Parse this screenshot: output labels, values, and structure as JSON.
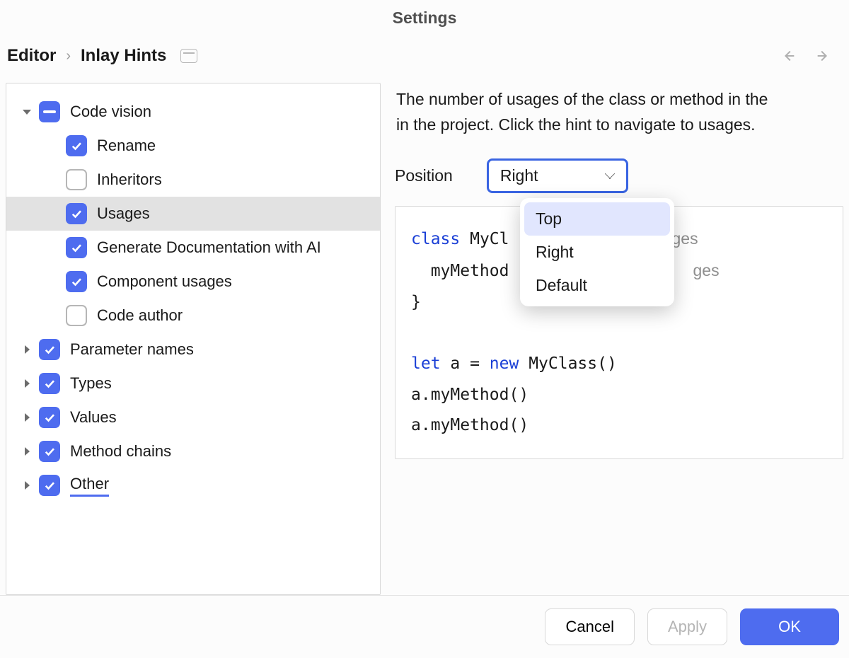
{
  "title": "Settings",
  "breadcrumb": {
    "parent": "Editor",
    "current": "Inlay Hints"
  },
  "tree": {
    "code_vision": {
      "label": "Code vision",
      "state": "indeterminate",
      "children": [
        {
          "key": "rename",
          "label": "Rename",
          "checked": true
        },
        {
          "key": "inheritors",
          "label": "Inheritors",
          "checked": false
        },
        {
          "key": "usages",
          "label": "Usages",
          "checked": true,
          "selected": true
        },
        {
          "key": "gen_doc_ai",
          "label": "Generate Documentation with AI",
          "checked": true
        },
        {
          "key": "comp_usages",
          "label": "Component usages",
          "checked": true
        },
        {
          "key": "code_author",
          "label": "Code author",
          "checked": false
        }
      ]
    },
    "param_names": {
      "label": "Parameter names",
      "checked": true
    },
    "types": {
      "label": "Types",
      "checked": true
    },
    "values": {
      "label": "Values",
      "checked": true
    },
    "method_chains": {
      "label": "Method chains",
      "checked": true
    },
    "other": {
      "label": "Other",
      "checked": true,
      "underline": true
    }
  },
  "detail": {
    "description_l1": "The number of usages of the class or method in the",
    "description_l2": "in the project. Click the hint to navigate to usages.",
    "position_label": "Position",
    "position_value": "Right",
    "position_options": [
      "Top",
      "Right",
      "Default"
    ],
    "position_highlight": "Top",
    "code_hint_suffix": "ges",
    "code": {
      "l1_kw": "class",
      "l1_rest": " MyCl",
      "l2_pre": "  myMethod",
      "l3": "}",
      "l4": "",
      "l5_kw1": "let",
      "l5_mid": " a = ",
      "l5_kw2": "new",
      "l5_rest": " MyClass()",
      "l6": "a.myMethod()",
      "l7": "a.myMethod()"
    }
  },
  "footer": {
    "cancel": "Cancel",
    "apply": "Apply",
    "ok": "OK"
  }
}
